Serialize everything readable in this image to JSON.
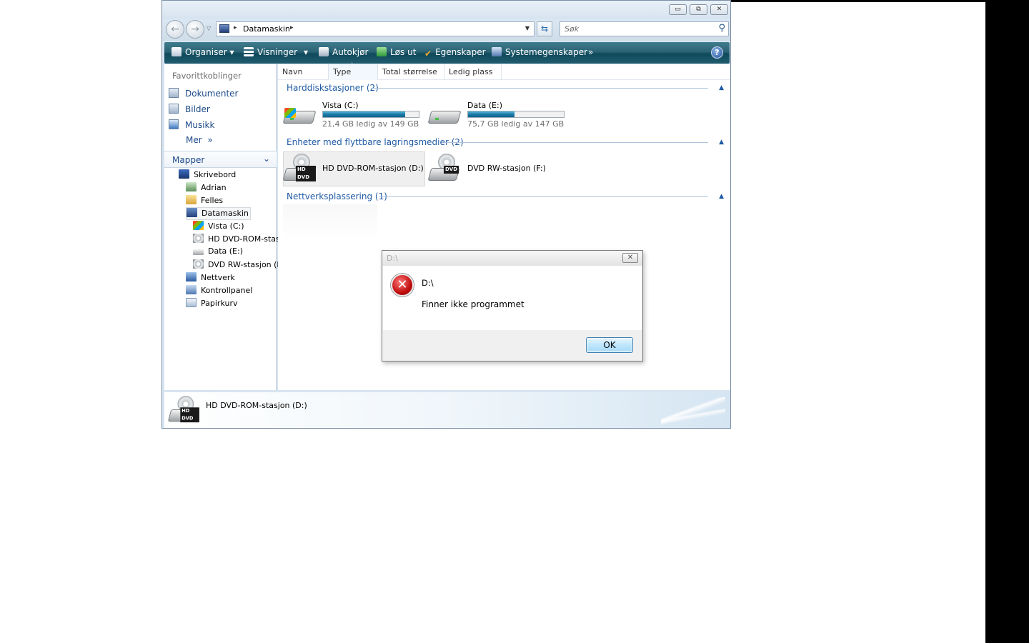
{
  "window": {
    "minimize_glyph": "▭",
    "maximize_glyph": "⧉",
    "close_glyph": "✕"
  },
  "address": {
    "back_glyph": "←",
    "forward_glyph": "→",
    "crumb": "Datamaskin",
    "refresh_glyph": "⇆",
    "search_placeholder": "Søk",
    "search_icon": "magnifier-icon"
  },
  "toolbar": {
    "organise": "Organiser",
    "views": "Visninger",
    "autoplay": "Autokjør",
    "eject": "Løs ut",
    "properties": "Egenskaper",
    "system_properties": "Systemegenskaper",
    "more": "»",
    "help": "?"
  },
  "sidebar": {
    "favorites_header": "Favorittkoblinger",
    "favorites": [
      {
        "label": "Dokumenter",
        "icon": "documents-icon"
      },
      {
        "label": "Bilder",
        "icon": "pictures-icon"
      },
      {
        "label": "Musikk",
        "icon": "music-icon"
      }
    ],
    "more_label": "Mer",
    "more_glyph": "»",
    "folders_header": "Mapper",
    "folders_caret": "⌄",
    "tree": [
      {
        "label": "Skrivebord",
        "icon": "desktop-icon"
      },
      {
        "label": "Adrian",
        "icon": "user-folder-icon"
      },
      {
        "label": "Felles",
        "icon": "folder-icon"
      },
      {
        "label": "Datamaskin",
        "icon": "computer-icon"
      },
      {
        "label": "Vista (C:)",
        "icon": "windows-drive-icon"
      },
      {
        "label": "HD DVD-ROM-stas",
        "icon": "dvd-drive-icon"
      },
      {
        "label": "Data (E:)",
        "icon": "hard-drive-icon"
      },
      {
        "label": "DVD RW-stasjon (F",
        "icon": "dvd-drive-icon"
      },
      {
        "label": "Nettverk",
        "icon": "network-icon"
      },
      {
        "label": "Kontrollpanel",
        "icon": "control-panel-icon"
      },
      {
        "label": "Papirkurv",
        "icon": "recycle-bin-icon"
      }
    ]
  },
  "columns": [
    "Navn",
    "Type",
    "Total størrelse",
    "Ledig plass"
  ],
  "sort_glyph": "ˆ",
  "groups": {
    "hdd": "Harddiskstasjoner (2)",
    "removable": "Enheter med flyttbare lagringsmedier (2)",
    "network": "Nettverksplassering (1)",
    "collapse_glyph": "▲"
  },
  "drives": {
    "c": {
      "name": "Vista (C:)",
      "free": "21,4 GB ledig av 149 GB",
      "used_fraction": 0.856
    },
    "e": {
      "name": "Data (E:)",
      "free": "75,7 GB ledig av 147 GB",
      "used_fraction": 0.485
    },
    "d": {
      "name": "HD DVD-ROM-stasjon (D:)",
      "tag": "HD DVD"
    },
    "f": {
      "name": "DVD RW-stasjon (F:)",
      "tag": "DVD"
    }
  },
  "details": {
    "label": "HD DVD-ROM-stasjon (D:)",
    "tag": "HD DVD"
  },
  "dialog": {
    "title": "D:\\",
    "close_glyph": "✕",
    "error_glyph": "✕",
    "path": "D:\\",
    "message": "Finner ikke programmet",
    "ok": "OK"
  },
  "colors": {
    "toolbar": "#215c6e",
    "link": "#1d4a89",
    "group_header": "#1e5aa5",
    "progress": "#1d7aa5"
  }
}
